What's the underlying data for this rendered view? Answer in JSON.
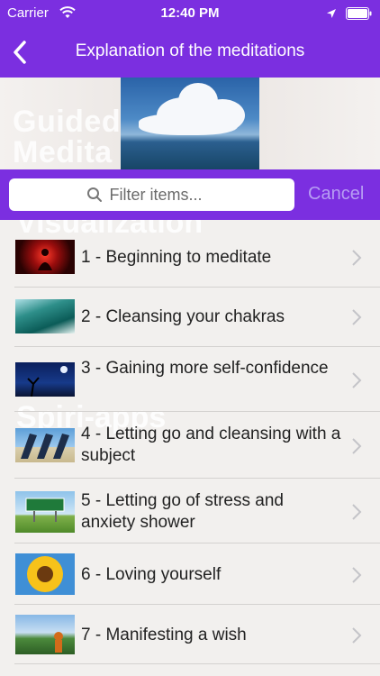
{
  "status_bar": {
    "carrier": "Carrier",
    "time": "12:40 PM",
    "icons": [
      "wifi-icon",
      "location-icon",
      "battery-icon"
    ]
  },
  "nav": {
    "title": "Explanation of the meditations",
    "back_icon": "chevron-left-icon"
  },
  "hero": {
    "bg_text_line1": "Guided",
    "bg_text_line2": "Medita"
  },
  "search": {
    "placeholder": "Filter items...",
    "value": "",
    "cancel_label": "Cancel"
  },
  "list_bg": {
    "line1": "Visualization",
    "line2": "Spiri-apps"
  },
  "items": [
    {
      "label": "1 - Beginning to meditate"
    },
    {
      "label": "2 - Cleansing your chakras"
    },
    {
      "label": "3 - Gaining more self-confidence"
    },
    {
      "label": "4 - Letting go and cleansing with a subject"
    },
    {
      "label": "5 - Letting go of stress and anxiety shower"
    },
    {
      "label": "6 - Loving yourself"
    },
    {
      "label": "7 - Manifesting a wish"
    }
  ],
  "colors": {
    "accent": "#7b2fe0",
    "cancel": "#b79ef3",
    "background": "#f2f0ee"
  }
}
